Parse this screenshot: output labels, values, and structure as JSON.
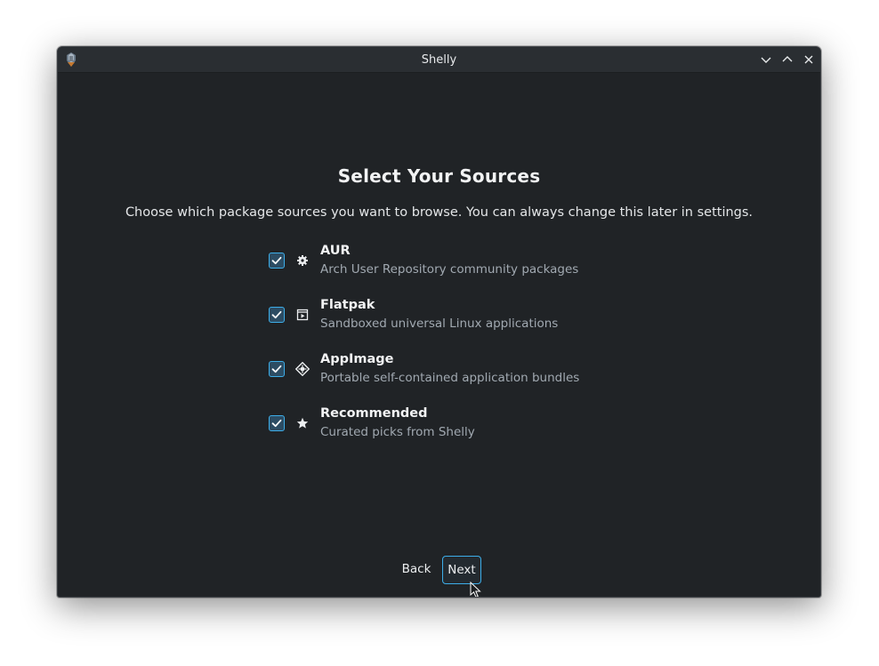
{
  "window": {
    "title": "Shelly"
  },
  "page": {
    "heading": "Select Your Sources",
    "subtitle": "Choose which package sources you want to browse. You can always change this later in settings."
  },
  "sources": [
    {
      "name": "AUR",
      "description": "Arch User Repository community packages",
      "icon": "gear-icon",
      "checked": true
    },
    {
      "name": "Flatpak",
      "description": "Sandboxed universal Linux applications",
      "icon": "flatpak-icon",
      "checked": true
    },
    {
      "name": "AppImage",
      "description": "Portable self-contained application bundles",
      "icon": "appimage-icon",
      "checked": true
    },
    {
      "name": "Recommended",
      "description": "Curated picks from Shelly",
      "icon": "star-icon",
      "checked": true
    }
  ],
  "buttons": {
    "back": "Back",
    "next": "Next"
  },
  "colors": {
    "accent": "#3daee9",
    "window_bg": "#202326",
    "titlebar_bg": "#2a2e32"
  }
}
